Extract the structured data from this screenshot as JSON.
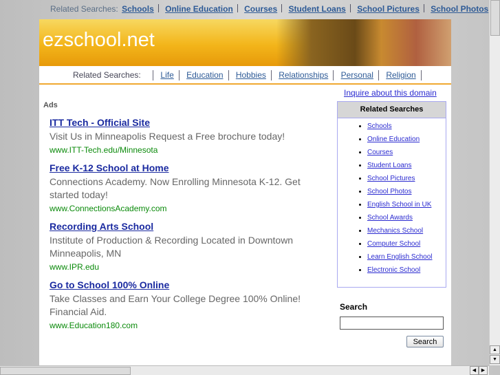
{
  "top_bar": {
    "label": "Related Searches:",
    "links": [
      "Schools",
      "Online Education",
      "Courses",
      "Student Loans",
      "School Pictures",
      "School Photos"
    ]
  },
  "header": {
    "logo": "ezschool.net"
  },
  "nav": {
    "label": "Related Searches:",
    "links": [
      "Life",
      "Education",
      "Hobbies",
      "Relationships",
      "Personal",
      "Religion"
    ]
  },
  "ads": {
    "heading": "Ads",
    "items": [
      {
        "title": "ITT Tech - Official Site",
        "desc": "Visit Us in Minneapolis Request a Free brochure today!",
        "url": "www.ITT-Tech.edu/Minnesota"
      },
      {
        "title": "Free K-12 School at Home",
        "desc": "Connections Academy. Now Enrolling Minnesota K-12. Get started today!",
        "url": "www.ConnectionsAcademy.com"
      },
      {
        "title": "Recording Arts School",
        "desc": "Institute of Production & Recording Located in Downtown Minneapolis, MN",
        "url": "www.IPR.edu"
      },
      {
        "title": "Go to School 100% Online",
        "desc": "Take Classes and Earn Your College Degree 100% Online! Financial Aid.",
        "url": "www.Education180.com"
      }
    ]
  },
  "sidebar": {
    "inquire": "Inquire about this domain",
    "related_heading": "Related Searches",
    "related": [
      "Schools",
      "Online Education",
      "Courses",
      "Student Loans",
      "School Pictures",
      "School Photos",
      "English School in UK",
      "School Awards",
      "Mechanics School",
      "Computer School",
      "Learn English School",
      "Electronic School"
    ],
    "search_heading": "Search",
    "search_value": "",
    "search_button": "Search"
  }
}
